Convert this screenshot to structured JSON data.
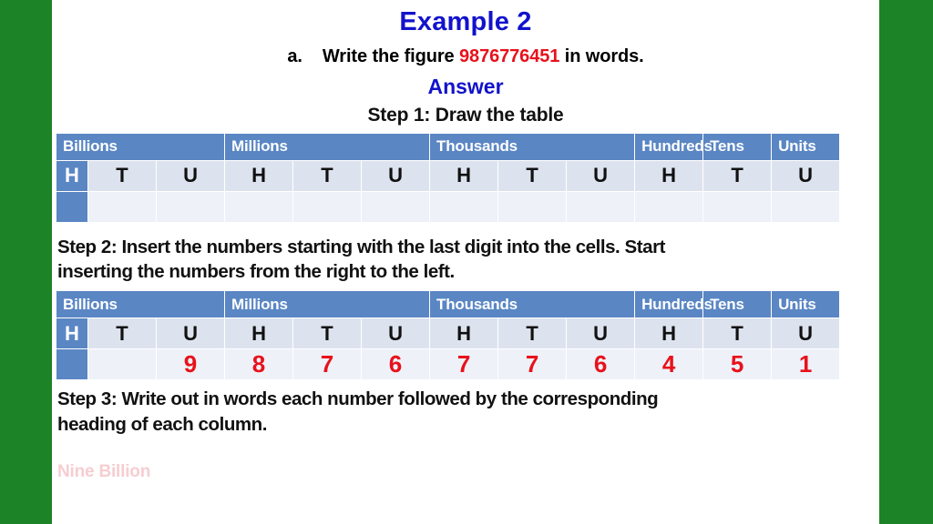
{
  "slide": {
    "title": "Example 2",
    "accent_blue": "#1212cc",
    "accent_red": "#e8111b",
    "table_header_blue": "#5a86c4",
    "side_bar_green": "#1c8327"
  },
  "question": {
    "label": "a.",
    "text_before": "Write the figure",
    "figure": "9876776451",
    "text_after": "in words."
  },
  "answer_heading": "Answer",
  "steps": {
    "step1": "Step 1: Draw the table",
    "step2_line1": "Step 2: Insert the numbers starting with the last digit into  the cells. Start",
    "step2_line2": "inserting the numbers from the right to the left.",
    "step3_line1": "Step 3: Write out in words each number followed by the corresponding",
    "step3_line2": "heading of each column."
  },
  "table": {
    "groups": [
      {
        "label": "Billions",
        "span": 3
      },
      {
        "label": "Millions",
        "span": 3
      },
      {
        "label": "Thousands",
        "span": 3
      },
      {
        "label": "Hundreds",
        "span": 1
      },
      {
        "label": "Tens",
        "span": 1
      },
      {
        "label": "Units",
        "span": 1
      }
    ],
    "letters": [
      "H",
      "T",
      "U",
      "H",
      "T",
      "U",
      "H",
      "T",
      "U",
      "H",
      "T",
      "U"
    ],
    "values_empty": [
      "",
      "",
      "",
      "",
      "",
      "",
      "",
      "",
      "",
      "",
      "",
      ""
    ],
    "values_filled": [
      "",
      "",
      "9",
      "8",
      "7",
      "6",
      "7",
      "7",
      "6",
      "4",
      "5",
      "1"
    ],
    "highlight_first_cell": true
  },
  "faded_answer": "Nine Billion"
}
